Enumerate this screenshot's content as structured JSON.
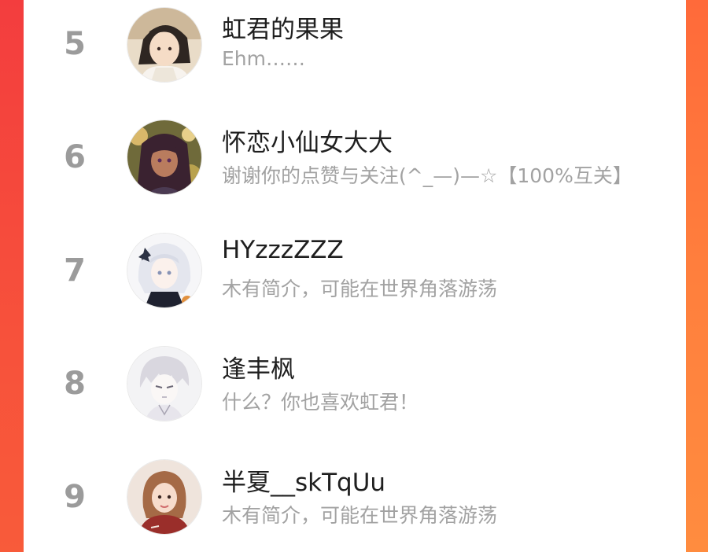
{
  "ranking": {
    "items": [
      {
        "rank": "5",
        "name": "虹君的果果",
        "bio": "Ehm……",
        "avatar_icon": "avatar-anime-boy-icon"
      },
      {
        "rank": "6",
        "name": "怀恋小仙女大大",
        "bio": "谢谢你的点赞与关注(^_—)—☆【100%互关】",
        "avatar_icon": "avatar-anime-girl-flowers-icon"
      },
      {
        "rank": "7",
        "name": "HYzzzZZZ",
        "bio": "木有简介，可能在世界角落游荡",
        "avatar_icon": "avatar-anime-white-hair-icon"
      },
      {
        "rank": "8",
        "name": "逢丰枫",
        "bio": "什么？你也喜欢虹君！",
        "avatar_icon": "avatar-anime-sketch-icon"
      },
      {
        "rank": "9",
        "name": "半夏__skTqUu",
        "bio": "木有简介，可能在世界角落游荡",
        "avatar_icon": "avatar-photo-girl-icon"
      }
    ]
  },
  "colors": {
    "background_left": "#f33d3e",
    "background_right": "#ff7f3d",
    "rank_text": "#9b9b9b",
    "name_text": "#1f1f1f",
    "bio_text": "#a2a2a2"
  }
}
